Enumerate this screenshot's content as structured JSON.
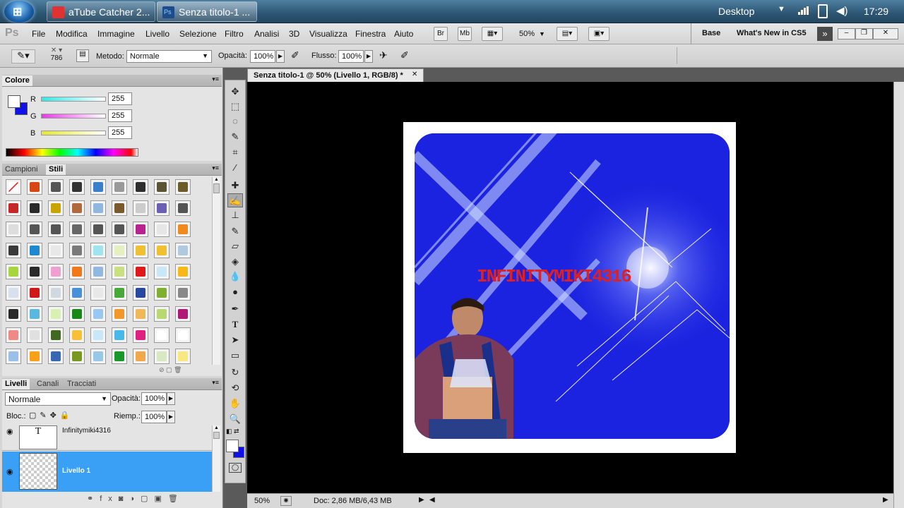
{
  "taskbar": {
    "start_label": "Start",
    "tasks": [
      {
        "label": "aTube Catcher 2...",
        "icon": "atube-icon"
      },
      {
        "label": "Senza titolo-1 ...",
        "icon": "photoshop-icon"
      }
    ],
    "desktop_label": "Desktop",
    "clock": "17:29"
  },
  "app": {
    "logo": "Ps",
    "menu": [
      "File",
      "Modifica",
      "Immagine",
      "Livello",
      "Selezione",
      "Filtro",
      "Analisi",
      "3D",
      "Visualizza",
      "Finestra",
      "Aiuto"
    ],
    "zoom": "50%",
    "workspace_base": "Base",
    "whats_new": "What's New in CS5",
    "mb_buttons": [
      "Br",
      "Mb"
    ]
  },
  "options": {
    "brush_size": "786",
    "metodo_label": "Metodo:",
    "metodo_value": "Normale",
    "opacita_label": "Opacità:",
    "opacita_value": "100%",
    "flusso_label": "Flusso:",
    "flusso_value": "100%"
  },
  "colore_panel": {
    "title": "Colore",
    "channels": [
      {
        "label": "R",
        "value": "255",
        "color": "#35e6e6"
      },
      {
        "label": "G",
        "value": "255",
        "color": "#e63be6"
      },
      {
        "label": "B",
        "value": "255",
        "color": "#e6e633"
      }
    ]
  },
  "styles_panel": {
    "tabs": [
      "Campioni",
      "Stili"
    ],
    "swatches": [
      "#ffffff",
      "#d94616",
      "#555555",
      "#333333",
      "#3a7fc9",
      "#999999",
      "#2e2e2e",
      "#5a5432",
      "#6b5c2a",
      "#c62828",
      "#2a2a2a",
      "#c9a400",
      "#b06a3a",
      "#8fb7e0",
      "#7a5a2a",
      "#cccccc",
      "#6b5fb2",
      "#555555",
      "#dddddd",
      "#555555",
      "#555555",
      "#666666",
      "#555555",
      "#555555",
      "#b8238f",
      "#e6e6e6",
      "#f08a1c",
      "#3a3a3a",
      "#1e88d0",
      "#e8e8e8",
      "#7a7a7a",
      "#a0e4f0",
      "#e4f0c0",
      "#f0c030",
      "#f0c030",
      "#b0c8e0",
      "#a6d63c",
      "#2a2a2a",
      "#f0a0d0",
      "#f07818",
      "#90b8e0",
      "#c8e080",
      "#e01818",
      "#c8e8f8",
      "#f8b818",
      "#d8e0f0",
      "#d01818",
      "#d0d8e0",
      "#4890d8",
      "#e8e8e8",
      "#48a838",
      "#2848a0",
      "#80b030",
      "#888888",
      "#2a2a2a",
      "#58b8e0",
      "#d8f0b0",
      "#188818",
      "#98c8f0",
      "#f09828",
      "#f0b858",
      "#b8d870",
      "#b01878",
      "#f08888",
      "#e0e0e0",
      "#406820",
      "#f8c038",
      "#c8e8f8",
      "#48b8e8",
      "#e02080",
      "#ffffff",
      "#ffffff",
      "#98c0e8",
      "#f8a018",
      "#3868b0",
      "#789820",
      "#98c8e8",
      "#189828",
      "#f0a848",
      "#d8e8c0",
      "#f8e880"
    ]
  },
  "layers_panel": {
    "tabs": [
      "Livelli",
      "Canali",
      "Tracciati"
    ],
    "blend_mode": "Normale",
    "opacita_label": "Opacità:",
    "opacita_value": "100%",
    "lock_label": "Bloc.:",
    "riemp_label": "Riemp.:",
    "riemp_value": "100%",
    "layers": [
      {
        "name": "Infinitymiki4316",
        "thumb": "T",
        "selected": false
      },
      {
        "name": "Livello 1",
        "thumb": "",
        "selected": true
      }
    ]
  },
  "document": {
    "tab_title": "Senza titolo-1 @ 50% (Livello 1, RGB/8) *",
    "zoom": "50%",
    "doc_info": "Doc: 2,86 MB/6,43 MB",
    "artwork_text": "INFINITYMIKI4316"
  }
}
